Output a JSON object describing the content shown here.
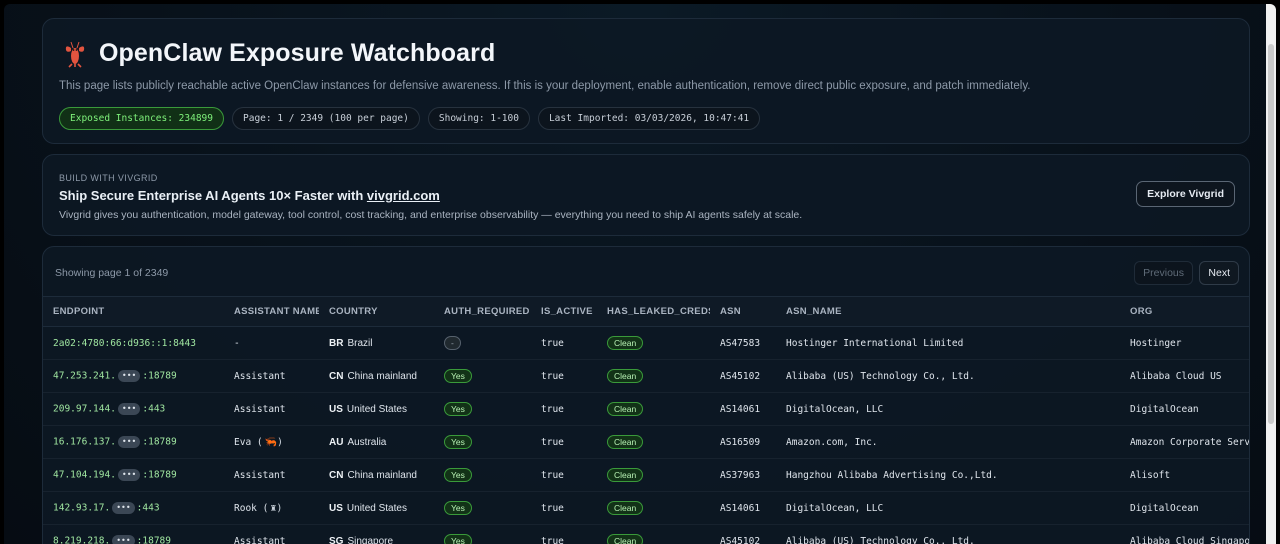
{
  "header": {
    "title": "OpenClaw Exposure Watchboard",
    "description": "This page lists publicly reachable active OpenClaw instances for defensive awareness. If this is your deployment, enable authentication, remove direct public exposure, and patch immediately.",
    "pills": {
      "exposed": "Exposed Instances: 234899",
      "page": "Page: 1 / 2349 (100 per page)",
      "showing": "Showing: 1-100",
      "imported": "Last Imported: 03/03/2026, 10:47:41"
    }
  },
  "promo": {
    "eyebrow": "BUILD WITH VIVGRID",
    "headline": "Ship Secure Enterprise AI Agents 10× Faster with ",
    "link": "vivgrid.com",
    "description": "Vivgrid gives you authentication, model gateway, tool control, cost tracking, and enterprise observability — everything you need to ship AI agents safely at scale.",
    "button": "Explore Vivgrid"
  },
  "table": {
    "showing_page": "Showing page 1 of 2349",
    "prev_label": "Previous",
    "next_label": "Next",
    "columns": [
      "ENDPOINT",
      "ASSISTANT NAME",
      "COUNTRY",
      "AUTH_REQUIRED",
      "IS_ACTIVE",
      "HAS_LEAKED_CREDS",
      "ASN",
      "ASN_NAME",
      "ORG"
    ],
    "rows": [
      {
        "ep_a": "2a02:4780:66:d936::1:8443",
        "ep_b": "",
        "masked": false,
        "assistant": "-",
        "assistant_icon": "",
        "cc": "BR",
        "country": "Brazil",
        "auth": "-",
        "auth_style": "neutral",
        "active": "true",
        "leaked": "Clean",
        "asn": "AS47583",
        "asn_name": "Hostinger International Limited",
        "org": "Hostinger"
      },
      {
        "ep_a": "47.253.241.",
        "ep_b": ":18789",
        "masked": true,
        "assistant": "Assistant",
        "assistant_icon": "",
        "cc": "CN",
        "country": "China mainland",
        "auth": "Yes",
        "auth_style": "green",
        "active": "true",
        "leaked": "Clean",
        "asn": "AS45102",
        "asn_name": "Alibaba (US) Technology Co., Ltd.",
        "org": "Alibaba Cloud US"
      },
      {
        "ep_a": "209.97.144.",
        "ep_b": ":443",
        "masked": true,
        "assistant": "Assistant",
        "assistant_icon": "",
        "cc": "US",
        "country": "United States",
        "auth": "Yes",
        "auth_style": "green",
        "active": "true",
        "leaked": "Clean",
        "asn": "AS14061",
        "asn_name": "DigitalOcean, LLC",
        "org": "DigitalOcean"
      },
      {
        "ep_a": "16.176.137.",
        "ep_b": ":18789",
        "masked": true,
        "assistant": "Eva (",
        "assistant_icon": "🦐)",
        "cc": "AU",
        "country": "Australia",
        "auth": "Yes",
        "auth_style": "green",
        "active": "true",
        "leaked": "Clean",
        "asn": "AS16509",
        "asn_name": "Amazon.com, Inc.",
        "org": "Amazon Corporate Serv"
      },
      {
        "ep_a": "47.104.194.",
        "ep_b": ":18789",
        "masked": true,
        "assistant": "Assistant",
        "assistant_icon": "",
        "cc": "CN",
        "country": "China mainland",
        "auth": "Yes",
        "auth_style": "green",
        "active": "true",
        "leaked": "Clean",
        "asn": "AS37963",
        "asn_name": "Hangzhou Alibaba Advertising Co.,Ltd.",
        "org": "Alisoft"
      },
      {
        "ep_a": "142.93.17.",
        "ep_b": ":443",
        "masked": true,
        "assistant": "Rook (",
        "assistant_icon": "♜)",
        "cc": "US",
        "country": "United States",
        "auth": "Yes",
        "auth_style": "green",
        "active": "true",
        "leaked": "Clean",
        "asn": "AS14061",
        "asn_name": "DigitalOcean, LLC",
        "org": "DigitalOcean"
      },
      {
        "ep_a": "8.219.218.",
        "ep_b": ":18789",
        "masked": true,
        "assistant": "Assistant",
        "assistant_icon": "",
        "cc": "SG",
        "country": "Singapore",
        "auth": "Yes",
        "auth_style": "green",
        "active": "true",
        "leaked": "Clean",
        "asn": "AS45102",
        "asn_name": "Alibaba (US) Technology Co., Ltd.",
        "org": "Alibaba Cloud Singapo"
      }
    ]
  },
  "mask_glyph": "•••",
  "colors": {
    "accent_green": "#7ef07a",
    "background": "#08111a",
    "card": "#0d1824"
  }
}
